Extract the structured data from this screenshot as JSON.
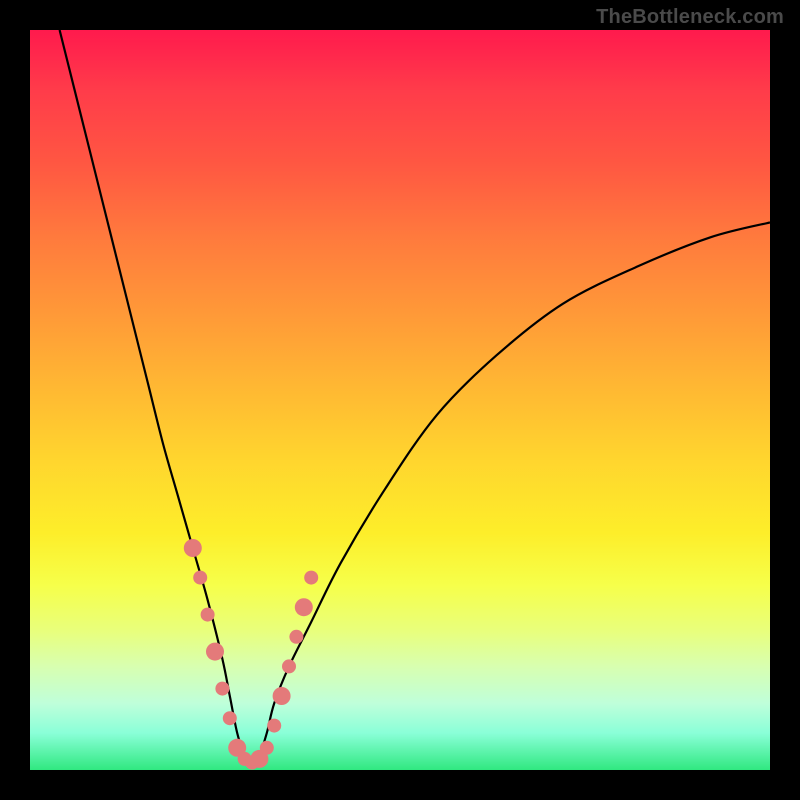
{
  "watermark": "TheBottleneck.com",
  "colors": {
    "frame": "#000000",
    "curve": "#000000",
    "marker_fill": "#e47a7a",
    "marker_stroke": "#c45a5a",
    "green": "#30e880"
  },
  "chart_data": {
    "type": "line",
    "title": "",
    "xlabel": "",
    "ylabel": "",
    "xlim": [
      0,
      100
    ],
    "ylim": [
      0,
      100
    ],
    "series": [
      {
        "name": "bottleneck-curve",
        "x": [
          4,
          6,
          8,
          10,
          12,
          14,
          16,
          18,
          20,
          22,
          24,
          26,
          27,
          28,
          29,
          30,
          31,
          32,
          33,
          35,
          38,
          42,
          48,
          55,
          63,
          72,
          82,
          92,
          100
        ],
        "values": [
          100,
          92,
          84,
          76,
          68,
          60,
          52,
          44,
          37,
          30,
          23,
          15,
          10,
          5,
          2,
          1,
          2,
          5,
          9,
          14,
          20,
          28,
          38,
          48,
          56,
          63,
          68,
          72,
          74
        ]
      }
    ],
    "markers": {
      "name": "highlight-dots",
      "x": [
        22,
        23,
        24,
        25,
        26,
        27,
        28,
        29,
        30,
        31,
        32,
        33,
        34,
        35,
        36,
        37,
        38
      ],
      "values": [
        30,
        26,
        21,
        16,
        11,
        7,
        3,
        1.5,
        1,
        1.5,
        3,
        6,
        10,
        14,
        18,
        22,
        26
      ]
    }
  }
}
